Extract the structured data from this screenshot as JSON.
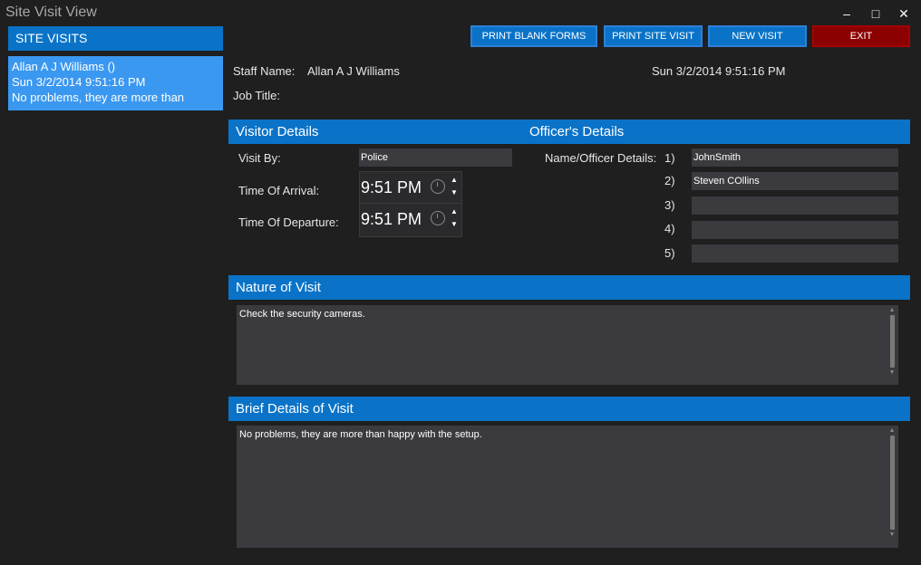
{
  "window": {
    "title": "Site Visit View",
    "minimize_label": "–",
    "maximize_label": "□",
    "close_label": "✕"
  },
  "sidebar": {
    "header": "SITE VISITS",
    "items": [
      {
        "line1": "Allan  A J Williams  ()",
        "line2": "Sun 3/2/2014  9:51:16 PM",
        "line3": "No problems, they are more than"
      }
    ]
  },
  "toolbar": {
    "print_blank_forms": "PRINT BLANK FORMS",
    "print_site_visit": "PRINT SITE VISIT",
    "new_visit": "NEW VISIT",
    "exit": "EXIT"
  },
  "staff": {
    "name_label": "Staff Name:",
    "name_value": "Allan A J Williams",
    "datetime": "Sun 3/2/2014 9:51:16 PM",
    "job_title_label": "Job Title:",
    "job_title_value": ""
  },
  "visitor": {
    "header": "Visitor Details",
    "visit_by_label": "Visit By:",
    "visit_by_value": "Police",
    "arrival_label": "Time Of Arrival:",
    "arrival_value": "9:51 PM",
    "departure_label": "Time Of Departure:",
    "departure_value": "9:51 PM"
  },
  "officers": {
    "header": "Officer's Details",
    "label": "Name/Officer Details:",
    "rows": [
      {
        "num": "1)",
        "value": "JohnSmith"
      },
      {
        "num": "2)",
        "value": "Steven COllins"
      },
      {
        "num": "3)",
        "value": ""
      },
      {
        "num": "4)",
        "value": ""
      },
      {
        "num": "5)",
        "value": ""
      }
    ]
  },
  "nature": {
    "header": "Nature of Visit",
    "text": "Check the security cameras."
  },
  "brief": {
    "header": "Brief Details of Visit",
    "text": "No problems, they are more than happy with the setup."
  },
  "colors": {
    "accent": "#0a73c8",
    "selected": "#3a98f0",
    "exit": "#8b0000",
    "background": "#1f1f1f",
    "field": "#3a3a3f"
  }
}
